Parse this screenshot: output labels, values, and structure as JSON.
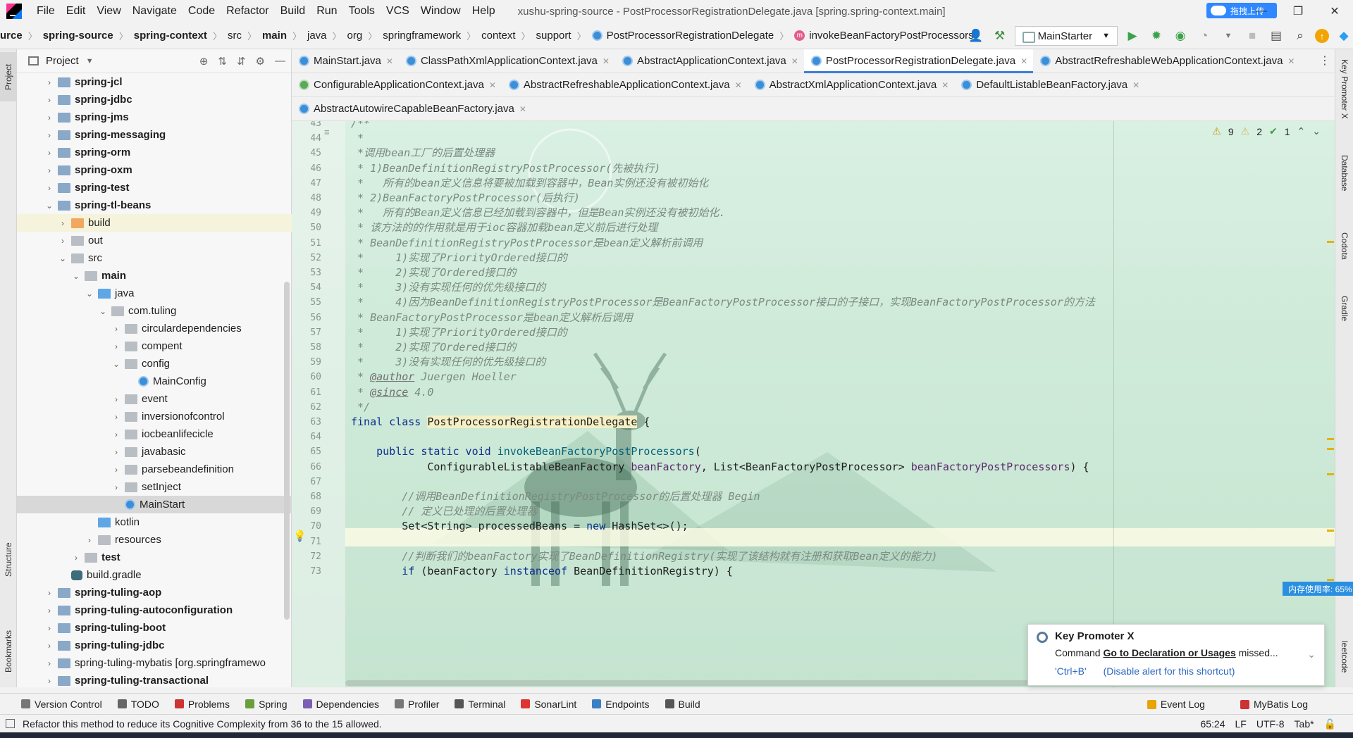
{
  "window": {
    "title": "xushu-spring-source - PostProcessorRegistrationDelegate.java [spring.spring-context.main]",
    "upload_label": "拖拽上传",
    "controls": [
      "—",
      "❐",
      "✕"
    ]
  },
  "menu": [
    "File",
    "Edit",
    "View",
    "Navigate",
    "Code",
    "Refactor",
    "Build",
    "Run",
    "Tools",
    "VCS",
    "Window",
    "Help"
  ],
  "breadcrumb": [
    "urce",
    "spring-source",
    "spring-context",
    "src",
    "main",
    "java",
    "org",
    "springframework",
    "context",
    "support",
    "PostProcessorRegistrationDelegate",
    "invokeBeanFactoryPostProcessors"
  ],
  "run_config": "MainStarter",
  "project_panel": {
    "title": "Project",
    "tree": [
      {
        "label": "spring-jcl",
        "depth": 0,
        "arrow": "›",
        "icon": "module",
        "bold": true
      },
      {
        "label": "spring-jdbc",
        "depth": 0,
        "arrow": "›",
        "icon": "module",
        "bold": true
      },
      {
        "label": "spring-jms",
        "depth": 0,
        "arrow": "›",
        "icon": "module",
        "bold": true
      },
      {
        "label": "spring-messaging",
        "depth": 0,
        "arrow": "›",
        "icon": "module",
        "bold": true
      },
      {
        "label": "spring-orm",
        "depth": 0,
        "arrow": "›",
        "icon": "module",
        "bold": true
      },
      {
        "label": "spring-oxm",
        "depth": 0,
        "arrow": "›",
        "icon": "module",
        "bold": true
      },
      {
        "label": "spring-test",
        "depth": 0,
        "arrow": "›",
        "icon": "module",
        "bold": true
      },
      {
        "label": "spring-tl-beans",
        "depth": 0,
        "arrow": "⌄",
        "icon": "module",
        "bold": true
      },
      {
        "label": "build",
        "depth": 1,
        "arrow": "›",
        "icon": "excl",
        "bold": false,
        "hl": true
      },
      {
        "label": "out",
        "depth": 1,
        "arrow": "›",
        "icon": "folder",
        "bold": false
      },
      {
        "label": "src",
        "depth": 1,
        "arrow": "⌄",
        "icon": "folder",
        "bold": false
      },
      {
        "label": "main",
        "depth": 2,
        "arrow": "⌄",
        "icon": "folder",
        "bold": true
      },
      {
        "label": "java",
        "depth": 3,
        "arrow": "⌄",
        "icon": "src",
        "bold": false
      },
      {
        "label": "com.tuling",
        "depth": 4,
        "arrow": "⌄",
        "icon": "folder",
        "bold": false
      },
      {
        "label": "circulardependencies",
        "depth": 5,
        "arrow": "›",
        "icon": "folder",
        "bold": false
      },
      {
        "label": "compent",
        "depth": 5,
        "arrow": "›",
        "icon": "folder",
        "bold": false
      },
      {
        "label": "config",
        "depth": 5,
        "arrow": "⌄",
        "icon": "folder",
        "bold": false
      },
      {
        "label": "MainConfig",
        "depth": 6,
        "arrow": "",
        "icon": "cls",
        "bold": false
      },
      {
        "label": "event",
        "depth": 5,
        "arrow": "›",
        "icon": "folder",
        "bold": false
      },
      {
        "label": "inversionofcontrol",
        "depth": 5,
        "arrow": "›",
        "icon": "folder",
        "bold": false
      },
      {
        "label": "iocbeanlifecicle",
        "depth": 5,
        "arrow": "›",
        "icon": "folder",
        "bold": false
      },
      {
        "label": "javabasic",
        "depth": 5,
        "arrow": "›",
        "icon": "folder",
        "bold": false
      },
      {
        "label": "parsebeandefinition",
        "depth": 5,
        "arrow": "›",
        "icon": "folder",
        "bold": false
      },
      {
        "label": "setInject",
        "depth": 5,
        "arrow": "›",
        "icon": "folder",
        "bold": false
      },
      {
        "label": "MainStart",
        "depth": 5,
        "arrow": "",
        "icon": "cls",
        "bold": false,
        "sel": true
      },
      {
        "label": "kotlin",
        "depth": 3,
        "arrow": "",
        "icon": "src",
        "bold": false
      },
      {
        "label": "resources",
        "depth": 3,
        "arrow": "›",
        "icon": "res",
        "bold": false
      },
      {
        "label": "test",
        "depth": 2,
        "arrow": "›",
        "icon": "folder",
        "bold": true
      },
      {
        "label": "build.gradle",
        "depth": 1,
        "arrow": "",
        "icon": "gradle",
        "bold": false
      },
      {
        "label": "spring-tuling-aop",
        "depth": 0,
        "arrow": "›",
        "icon": "module",
        "bold": true
      },
      {
        "label": "spring-tuling-autoconfiguration",
        "depth": 0,
        "arrow": "›",
        "icon": "module",
        "bold": true
      },
      {
        "label": "spring-tuling-boot",
        "depth": 0,
        "arrow": "›",
        "icon": "module",
        "bold": true
      },
      {
        "label": "spring-tuling-jdbc",
        "depth": 0,
        "arrow": "›",
        "icon": "module",
        "bold": true
      },
      {
        "label": "spring-tuling-mybatis [org.springframewo",
        "depth": 0,
        "arrow": "›",
        "icon": "module",
        "bold": false
      },
      {
        "label": "spring-tuling-transactional",
        "depth": 0,
        "arrow": "›",
        "icon": "module",
        "bold": true
      }
    ]
  },
  "tabs": [
    [
      {
        "label": "MainStart.java",
        "kind": "class"
      },
      {
        "label": "ClassPathXmlApplicationContext.java",
        "kind": "class"
      },
      {
        "label": "AbstractApplicationContext.java",
        "kind": "class"
      },
      {
        "label": "PostProcessorRegistrationDelegate.java",
        "kind": "class",
        "active": true
      },
      {
        "label": "AbstractRefreshableWebApplicationContext.java",
        "kind": "class"
      }
    ],
    [
      {
        "label": "ConfigurableApplicationContext.java",
        "kind": "iface"
      },
      {
        "label": "AbstractRefreshableApplicationContext.java",
        "kind": "class"
      },
      {
        "label": "AbstractXmlApplicationContext.java",
        "kind": "class"
      },
      {
        "label": "DefaultListableBeanFactory.java",
        "kind": "class"
      }
    ],
    [
      {
        "label": "AbstractAutowireCapableBeanFactory.java",
        "kind": "class"
      }
    ]
  ],
  "inspections": {
    "warnings": "9",
    "weak": "2",
    "ok": "1"
  },
  "code": [
    {
      "n": "43",
      "html": "<span class='cm'>/**</span>"
    },
    {
      "n": "44",
      "html": "<span class='cm'> *</span>"
    },
    {
      "n": "45",
      "html": "<span class='cm'> *调用bean工厂的后置处理器</span>"
    },
    {
      "n": "46",
      "html": "<span class='cm'> * 1)BeanDefinitionRegistryPostProcessor(先被执行)</span>"
    },
    {
      "n": "47",
      "html": "<span class='cm'> *   所有的bean定义信息将要被加载到容器中，Bean实例还没有被初始化</span>"
    },
    {
      "n": "48",
      "html": "<span class='cm'> * 2)BeanFactoryPostProcessor(后执行)</span>"
    },
    {
      "n": "49",
      "html": "<span class='cm'> *   所有的Bean定义信息已经加载到容器中，但是Bean实例还没有被初始化.</span>"
    },
    {
      "n": "50",
      "html": "<span class='cm'> * 该方法的的作用就是用于ioc容器加载bean定义前后进行处理</span>"
    },
    {
      "n": "51",
      "html": "<span class='cm'> * BeanDefinitionRegistryPostProcessor是bean定义解析前调用</span>"
    },
    {
      "n": "52",
      "html": "<span class='cm'> *     1)实现了PriorityOrdered接口的</span>"
    },
    {
      "n": "53",
      "html": "<span class='cm'> *     2)实现了Ordered接口的</span>"
    },
    {
      "n": "54",
      "html": "<span class='cm'> *     3)没有实现任何的优先级接口的</span>"
    },
    {
      "n": "55",
      "html": "<span class='cm'> *     4)因为BeanDefinitionRegistryPostProcessor是BeanFactoryPostProcessor接口的子接口，实现BeanFactoryPostProcessor的方法</span>"
    },
    {
      "n": "56",
      "html": "<span class='cm'> * BeanFactoryPostProcessor是bean定义解析后调用</span>"
    },
    {
      "n": "57",
      "html": "<span class='cm'> *     1)实现了PriorityOrdered接口的</span>"
    },
    {
      "n": "58",
      "html": "<span class='cm'> *     2)实现了Ordered接口的</span>"
    },
    {
      "n": "59",
      "html": "<span class='cm'> *     3)没有实现任何的优先级接口的</span>"
    },
    {
      "n": "60",
      "html": "<span class='cm'> * <span class='tag'>@author</span> Juergen Hoeller</span>"
    },
    {
      "n": "61",
      "html": "<span class='cm'> * <span class='tag'>@since</span> 4.0</span>"
    },
    {
      "n": "62",
      "html": "<span class='cm'> */</span>"
    },
    {
      "n": "63",
      "html": "<span class='kw'>final class</span> <span class='cls-hl'>PostProcessorRegistrationDelegate</span> {"
    },
    {
      "n": "64",
      "html": ""
    },
    {
      "n": "65",
      "html": "    <span class='kw'>public static void</span> <span class='method'>invokeBeanFactoryPostProcessors</span>("
    },
    {
      "n": "66",
      "html": "            ConfigurableListableBeanFactory <span class='param'>beanFactory</span>, List&lt;BeanFactoryPostProcessor&gt; <span class='param'>beanFactoryPostProcessors</span>) {"
    },
    {
      "n": "67",
      "html": ""
    },
    {
      "n": "68",
      "html": "        <span class='cm'>//调用BeanDefinitionRegistryPostProcessor的后置处理器 Begin</span>"
    },
    {
      "n": "69",
      "html": "        <span class='cm'>// 定义已处理的后置处理器</span>"
    },
    {
      "n": "70",
      "html": "        Set&lt;String&gt; processedBeans = <span class='kw'>new</span> HashSet&lt;&gt;();"
    },
    {
      "n": "71",
      "html": ""
    },
    {
      "n": "72",
      "html": "        <span class='cm'>//判断我们的beanFactory实现了BeanDefinitionRegistry(实现了该结构就有注册和获取Bean定义的能力)</span>"
    },
    {
      "n": "73",
      "html": "        <span class='kw'>if</span> (beanFactory <span class='kw'>instanceof</span> BeanDefinitionRegistry) {"
    }
  ],
  "memory_badge": "内存使用率: 65%",
  "notification": {
    "title": "Key Promoter X",
    "body_prefix": "Command ",
    "body_link": "Go to Declaration or Usages",
    "body_suffix": " missed...",
    "shortcut": "'Ctrl+B'",
    "disable": "(Disable alert for this shortcut)"
  },
  "bottom_tools": [
    "Version Control",
    "TODO",
    "Problems",
    "Spring",
    "Dependencies",
    "Profiler",
    "Terminal",
    "SonarLint",
    "Endpoints",
    "Build"
  ],
  "bottom_right_tools": [
    "Event Log",
    "MyBatis Log"
  ],
  "status": {
    "message": "Refactor this method to reduce its Cognitive Complexity from 36 to the 15 allowed.",
    "position": "65:24",
    "line_sep": "LF",
    "encoding": "UTF-8",
    "indent": "Tab*"
  },
  "side_tabs": {
    "left": [
      "Project",
      "Structure",
      "Bookmarks"
    ],
    "right": [
      "Key Promoter X",
      "Database",
      "Codota",
      "Gradle",
      "leetcode"
    ]
  }
}
